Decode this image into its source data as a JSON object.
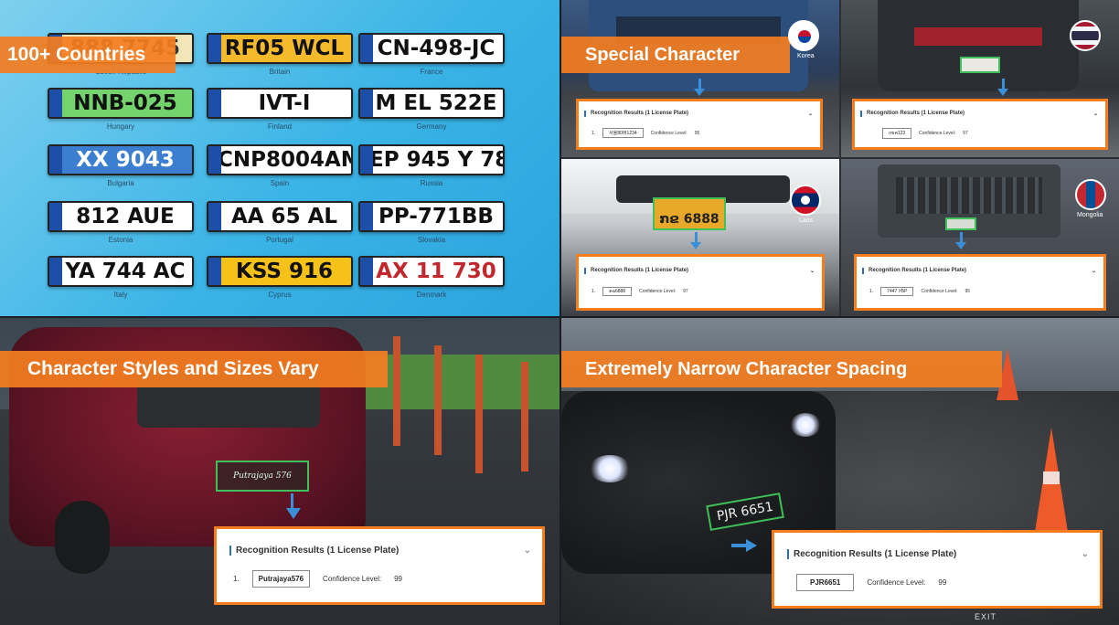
{
  "countries_panel": {
    "title": "100+ Countries",
    "plates": [
      {
        "text": "888 7745",
        "country": "Czech Republic",
        "bg": "#f2e6b8",
        "fg": "#333"
      },
      {
        "text": "RF05 WCL",
        "country": "Britain",
        "bg": "#f5b92c",
        "fg": "#111"
      },
      {
        "text": "CN-498-JC",
        "country": "France",
        "bg": "#ffffff",
        "fg": "#111"
      },
      {
        "text": "NNB-025",
        "country": "Hungary",
        "bg": "#74d36d",
        "fg": "#111"
      },
      {
        "text": "IVT-I",
        "country": "Finland",
        "bg": "#ffffff",
        "fg": "#111"
      },
      {
        "text": "M EL 522E",
        "country": "Germany",
        "bg": "#ffffff",
        "fg": "#111"
      },
      {
        "text": "XX 9043",
        "country": "Bulgaria",
        "bg": "#3c7fd1",
        "fg": "#ffffff"
      },
      {
        "text": "CNP8004AM",
        "country": "Spain",
        "bg": "#ffffff",
        "fg": "#111"
      },
      {
        "text": "EP 945 Y 78",
        "country": "Russia",
        "bg": "#ffffff",
        "fg": "#111"
      },
      {
        "text": "812 AUE",
        "country": "Estonia",
        "bg": "#ffffff",
        "fg": "#111"
      },
      {
        "text": "AA 65 AL",
        "country": "Portugal",
        "bg": "#ffffff",
        "fg": "#111"
      },
      {
        "text": "PP-771BB",
        "country": "Slovakia",
        "bg": "#ffffff",
        "fg": "#111"
      },
      {
        "text": "YA 744 AC",
        "country": "Italy",
        "bg": "#ffffff",
        "fg": "#111"
      },
      {
        "text": "KSS 916",
        "country": "Cyprus",
        "bg": "#f6c21a",
        "fg": "#111"
      },
      {
        "text": "AX 11 730",
        "country": "Denmark",
        "bg": "#ffffff",
        "fg": "#c0282d"
      }
    ]
  },
  "special_panel": {
    "title": "Special Character",
    "scenes": [
      {
        "flag_label": "Korea",
        "card_title": "Recognition Results (1 License Plate)",
        "index": "1.",
        "plate": "서울80버1234",
        "conf_label": "Confidence Level:",
        "conf": "95"
      },
      {
        "flag_label": "",
        "card_title": "Recognition Results (1 License Plate)",
        "index": "1.",
        "plate": "กขค123",
        "conf_label": "Confidence Level:",
        "conf": "97"
      },
      {
        "flag_label": "Laos",
        "card_title": "Recognition Results (1 License Plate)",
        "index": "1.",
        "plate": "ກຂ6888",
        "conf_label": "Confidence Level:",
        "conf": "97"
      },
      {
        "flag_label": "Mongolia",
        "card_title": "Recognition Results (1 License Plate)",
        "index": "1.",
        "plate": "7447 УБР",
        "conf_label": "Confidence Level:",
        "conf": "95"
      }
    ]
  },
  "styles_panel": {
    "title": "Character Styles and Sizes Vary",
    "card_title": "Recognition Results (1 License Plate)",
    "index": "1.",
    "plate": "Putrajaya576",
    "conf_label": "Confidence Level:",
    "conf": "99",
    "scene_plate": "Putrajaya 576"
  },
  "narrow_panel": {
    "title": "Extremely Narrow Character Spacing",
    "card_title": "Recognition Results (1 License Plate)",
    "index": "1.",
    "plate": "PJR6651",
    "conf_label": "Confidence Level:",
    "conf": "99",
    "scene_plate": "PJR 6651"
  },
  "exit_label": "EXIT",
  "colors": {
    "accent_orange": "#f47d20",
    "arrow_blue": "#3b8fd9",
    "detect_green": "#3fc05a"
  }
}
